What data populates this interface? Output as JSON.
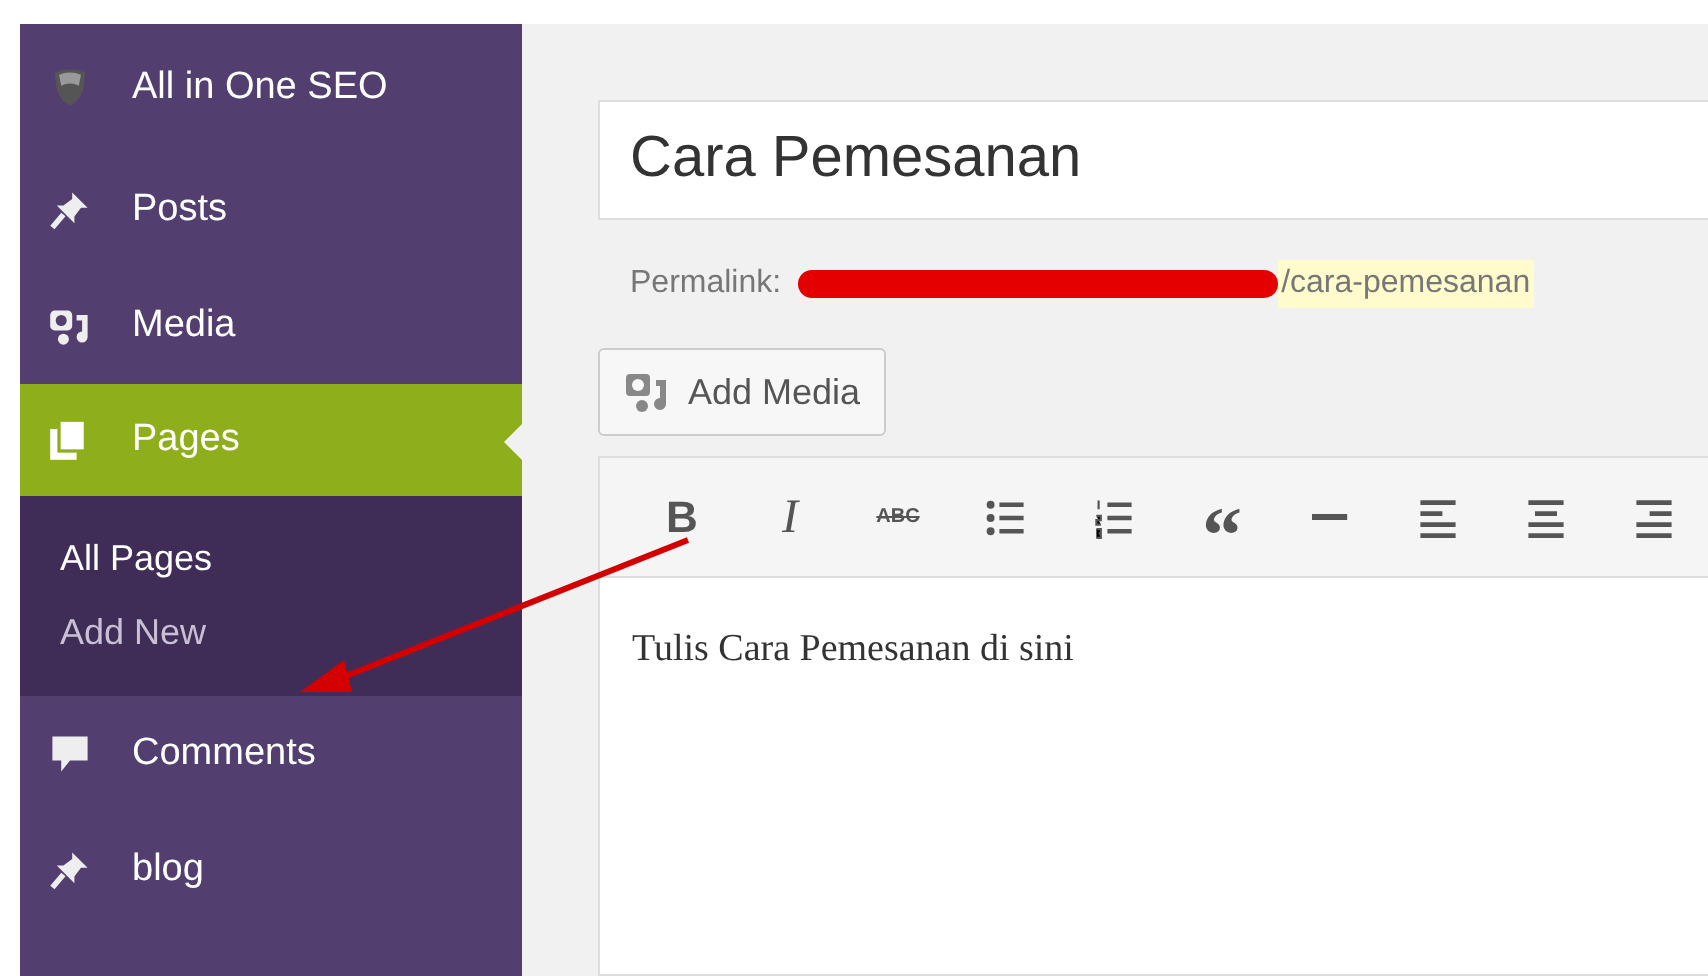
{
  "sidebar": {
    "items": [
      {
        "label": "All in One SEO",
        "kind": "shield",
        "selected": false
      },
      {
        "label": "Posts",
        "kind": "pin",
        "selected": false
      },
      {
        "label": "Media",
        "kind": "media",
        "selected": false
      },
      {
        "label": "Pages",
        "kind": "pages",
        "selected": true,
        "children": [
          {
            "label": "All Pages",
            "selected": true
          },
          {
            "label": "Add New",
            "selected": false
          }
        ]
      },
      {
        "label": "Comments",
        "kind": "comment",
        "selected": false
      },
      {
        "label": "blog",
        "kind": "pin",
        "selected": false
      }
    ]
  },
  "editor": {
    "title": "Cara Pemesanan",
    "permalink_label": "Permalink:",
    "permalink_slug": "/cara-pemesanan",
    "add_media": "Add Media",
    "toolbar": [
      {
        "kind": "bold",
        "label": "B"
      },
      {
        "kind": "italic",
        "label": "I"
      },
      {
        "kind": "strike",
        "label": "ABC"
      },
      {
        "kind": "bullets"
      },
      {
        "kind": "numbers"
      },
      {
        "kind": "quote",
        "label": "“"
      },
      {
        "kind": "rule"
      },
      {
        "kind": "align-left"
      },
      {
        "kind": "align-center"
      },
      {
        "kind": "align-right"
      }
    ],
    "content": "Tulis Cara Pemesanan di sini"
  }
}
